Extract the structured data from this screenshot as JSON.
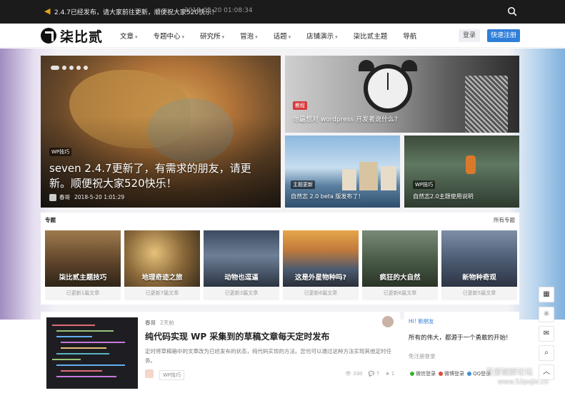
{
  "topbar": {
    "notice": "2.4.7已经发布，请大家前往更新，顺便祝大家520快乐！",
    "date": "2018-05-20 01:08:34"
  },
  "header": {
    "logo_text": "柒比贰",
    "nav": [
      {
        "label": "文章",
        "dropdown": true
      },
      {
        "label": "专题中心",
        "dropdown": true
      },
      {
        "label": "研究所",
        "dropdown": true
      },
      {
        "label": "冒泡",
        "dropdown": true
      },
      {
        "label": "话题",
        "dropdown": true
      },
      {
        "label": "店铺演示",
        "dropdown": true
      },
      {
        "label": "柒比贰主题",
        "dropdown": false
      },
      {
        "label": "导航",
        "dropdown": false
      }
    ],
    "login_label": "登录",
    "register_label": "快速注册"
  },
  "hero": {
    "main": {
      "tag": "WP技巧",
      "title": "seven 2.4.7更新了，有需求的朋友，请更新。顺便祝大家520快乐！",
      "author": "春哥",
      "date": "2018-5-20 1:01:29"
    },
    "clock": {
      "tag": "教程",
      "title": "你最想对 wordpress 开发者说什么?"
    },
    "city": {
      "tag": "主题更新",
      "title": "自然志 2.0 beta 版发布了！"
    },
    "forest": {
      "tag": "WP技巧",
      "title": "自然志2.0主题使用说明"
    }
  },
  "topics": {
    "header": "专题",
    "all_label": "所有专题",
    "items": [
      {
        "label": "柒比贰主题技巧",
        "count": "已更新1篇文章"
      },
      {
        "label": "地理奇迹之旅",
        "count": "已更新7篇文章"
      },
      {
        "label": "动物也逗逼",
        "count": "已更新3篇文章"
      },
      {
        "label": "这是外星物种吗?",
        "count": "已更新6篇文章"
      },
      {
        "label": "疯狂的大自然",
        "count": "已更新6篇文章"
      },
      {
        "label": "新物种奇观",
        "count": "已更新5篇文章"
      }
    ]
  },
  "article": {
    "author": "春哥",
    "time": "2天前",
    "title": "纯代码实现 WP 采集到的草稿文章每天定时发布",
    "excerpt": "定时将草稿箱中的文章改为已经发布的状态，纯代码实现的方法。您也可以通过这种方法实现其他定时任务。",
    "category": "WP技巧",
    "views": "330",
    "comments": "7",
    "likes": "1"
  },
  "sidebar": {
    "hi": "Hi! 新朋友",
    "line": "所有的伟大，都源于一个勇敢的开始!",
    "register_hint": "免注册登录",
    "social": [
      {
        "label": "微信登录",
        "color": "#3cb034"
      },
      {
        "label": "微博登录",
        "color": "#e0463a"
      },
      {
        "label": "QQ登录",
        "color": "#3d8fd8"
      }
    ]
  },
  "watermark": {
    "line1": "吾爱破解论坛",
    "line2": "www.52pojie.cn"
  }
}
